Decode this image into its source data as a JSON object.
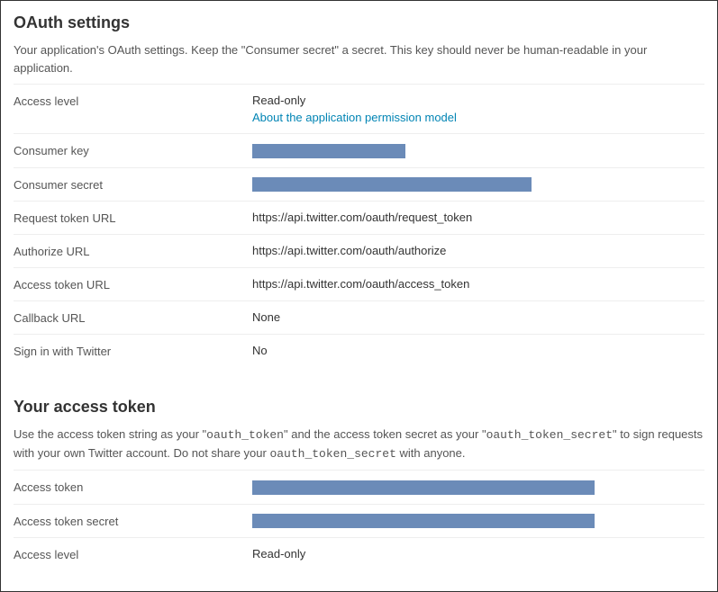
{
  "oauth": {
    "heading": "OAuth settings",
    "desc": "Your application's OAuth settings. Keep the \"Consumer secret\" a secret. This key should never be human-readable in your application.",
    "access_level": {
      "label": "Access level",
      "value": "Read-only",
      "link": "About the application permission model"
    },
    "consumer_key": {
      "label": "Consumer key"
    },
    "consumer_secret": {
      "label": "Consumer secret"
    },
    "request_token_url": {
      "label": "Request token URL",
      "value": "https://api.twitter.com/oauth/request_token"
    },
    "authorize_url": {
      "label": "Authorize URL",
      "value": "https://api.twitter.com/oauth/authorize"
    },
    "access_token_url": {
      "label": "Access token URL",
      "value": "https://api.twitter.com/oauth/access_token"
    },
    "callback_url": {
      "label": "Callback URL",
      "value": "None"
    },
    "sign_in": {
      "label": "Sign in with Twitter",
      "value": "No"
    }
  },
  "token": {
    "heading": "Your access token",
    "desc_prefix": "Use the access token string as your \"",
    "desc_oauth_token": "oauth_token",
    "desc_mid": "\" and the access token secret as your \"",
    "desc_oauth_token_secret": "oauth_token_secret",
    "desc_mid2": "\" to sign requests with your own Twitter account. Do not share your ",
    "desc_oauth_token_secret2": "oauth_token_secret",
    "desc_suffix": " with anyone.",
    "access_token": {
      "label": "Access token"
    },
    "access_token_secret": {
      "label": "Access token secret"
    },
    "access_level": {
      "label": "Access level",
      "value": "Read-only"
    }
  }
}
